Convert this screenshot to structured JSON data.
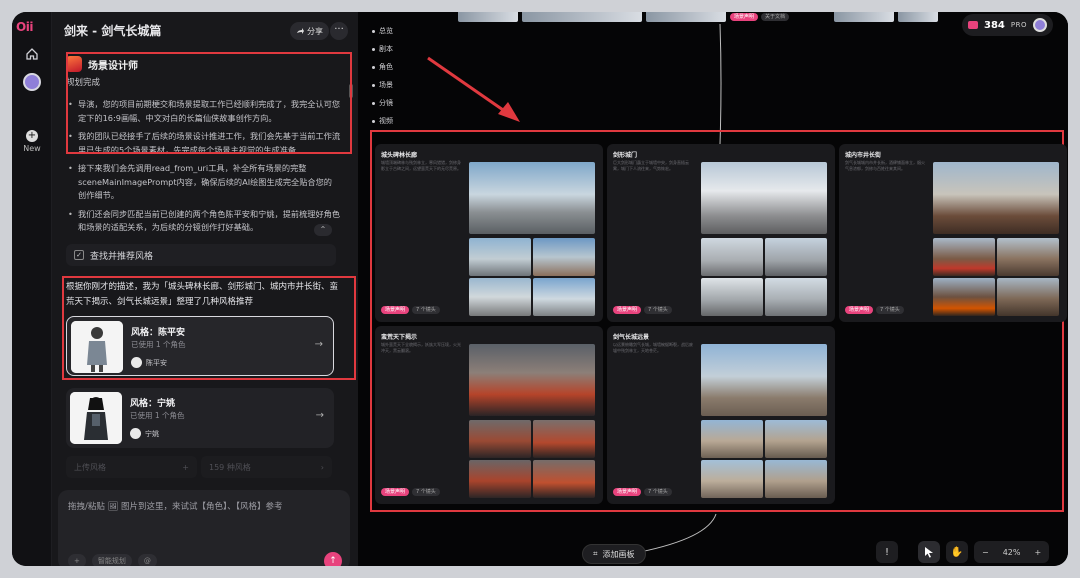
{
  "app": {
    "logo_text": "Oii",
    "new_label": "New"
  },
  "chat": {
    "title": "剑来 - 剑气长城篇",
    "share_label": "分享",
    "more_label": "···",
    "agent_name": "场景设计师",
    "status": "规划完成",
    "bullets": [
      "导演，您的项目前期梗交和场景提取工作已经顺利完成了，我完全认可您定下的16:9画幅、中文对白的长篇仙侠故事创作方向。",
      "我的团队已经接手了后续的场景设计推进工作，我们会先基于当前工作流里已生成的5个场景素材，先完成每个场景主视觉的生成准备",
      "接下来我们会先调用read_from_uri工具，补全所有场景的完整sceneMainImagePrompt内容，确保后续的AI绘图生成完全贴合您的创作细节。",
      "我们还会同步匹配当前已创建的两个角色陈平安和宁姚，提前梳理好角色和场景的适配关系，为后续的分镜创作打好基础。"
    ],
    "tool_label": "查找并推荐风格",
    "style_intro": "根据你刚才的描述，我为「城头碑林长廊、剑形城门、城内市井长街、蛮荒天下揭示、剑气长城远景」整理了几种风格推荐",
    "styles": [
      {
        "name": "风格：陈平安",
        "used": "已使用 1 个角色",
        "character": "陈平安"
      },
      {
        "name": "风格：宁姚",
        "used": "已使用 1 个角色",
        "character": "宁姚"
      }
    ],
    "upload_left": "上传风格",
    "upload_right": "159 种风格",
    "input_placeholder": "拖拽/粘贴 🖼 图片到这里，来试试【角色】、【风格】参考",
    "input_chip": "智能规划"
  },
  "canvas": {
    "credits": "384",
    "plan": "PRO",
    "side_nav": [
      "总览",
      "剧本",
      "角色",
      "场景",
      "分镜",
      "视频"
    ],
    "top_tag_pink": "场景声明",
    "top_tag_gray": "关于文档",
    "scenes": [
      {
        "title": "城头碑林长廊",
        "desc": "城墙顶端碑林与残剑林立，寒风猎猎，剑修身影立于古碑之间，远望蛮荒天下的无尽荒原。"
      },
      {
        "title": "剑形城门",
        "desc": "巨大剑形城门矗立于城墙中央，剑身直插云霄，城门下人流往来，气势恢宏。"
      },
      {
        "title": "城内市井长街",
        "desc": "剑气长城城内市井长街，酒肆铺面林立，烟火气息浓郁，剑修与百姓往来其间。"
      },
      {
        "title": "蛮荒天下揭示",
        "desc": "城外蛮荒天下全貌揭示，妖族大军压境，火光冲天，黑云翻滚。"
      },
      {
        "title": "剑气长城远景",
        "desc": "以远景俯瞰剑气长城，城墙蜿蜒断裂，战后废墟中残剑林立，天地苍茫。"
      }
    ],
    "scene_tag_pink": "场景声明",
    "scene_tag_gray": "7 个镜头",
    "add_board_label": "添加画板",
    "zoom": "42%",
    "zoom_minus": "−",
    "zoom_plus": "+"
  }
}
